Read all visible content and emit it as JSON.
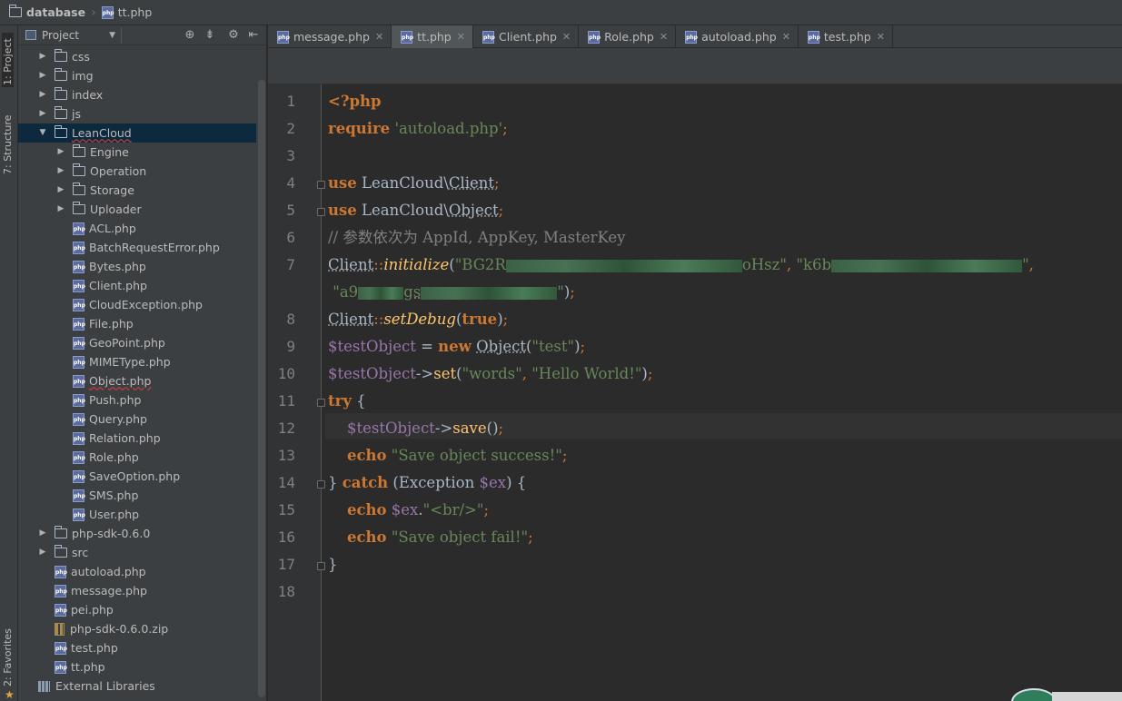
{
  "breadcrumb": {
    "root": "database",
    "file": "tt.php"
  },
  "toolwindows": {
    "project": "1: Project",
    "structure": "7: Structure",
    "favorites": "2: Favorites"
  },
  "project_panel": {
    "view_label": "Project"
  },
  "tree": [
    {
      "label": "css",
      "type": "folder",
      "depth": 1,
      "expanded": false
    },
    {
      "label": "img",
      "type": "folder",
      "depth": 1,
      "expanded": false
    },
    {
      "label": "index",
      "type": "folder",
      "depth": 1,
      "expanded": false
    },
    {
      "label": "js",
      "type": "folder",
      "depth": 1,
      "expanded": false
    },
    {
      "label": "LeanCloud",
      "type": "folder",
      "depth": 1,
      "expanded": true,
      "selected": true
    },
    {
      "label": "Engine",
      "type": "folder",
      "depth": 2,
      "expanded": false
    },
    {
      "label": "Operation",
      "type": "folder",
      "depth": 2,
      "expanded": false
    },
    {
      "label": "Storage",
      "type": "folder",
      "depth": 2,
      "expanded": false
    },
    {
      "label": "Uploader",
      "type": "folder",
      "depth": 2,
      "expanded": false
    },
    {
      "label": "ACL.php",
      "type": "php",
      "depth": 2
    },
    {
      "label": "BatchRequestError.php",
      "type": "php",
      "depth": 2
    },
    {
      "label": "Bytes.php",
      "type": "php",
      "depth": 2
    },
    {
      "label": "Client.php",
      "type": "php",
      "depth": 2
    },
    {
      "label": "CloudException.php",
      "type": "php",
      "depth": 2
    },
    {
      "label": "File.php",
      "type": "php",
      "depth": 2
    },
    {
      "label": "GeoPoint.php",
      "type": "php",
      "depth": 2
    },
    {
      "label": "MIMEType.php",
      "type": "php",
      "depth": 2
    },
    {
      "label": "Object.php",
      "type": "php",
      "depth": 2,
      "error": true
    },
    {
      "label": "Push.php",
      "type": "php",
      "depth": 2
    },
    {
      "label": "Query.php",
      "type": "php",
      "depth": 2
    },
    {
      "label": "Relation.php",
      "type": "php",
      "depth": 2
    },
    {
      "label": "Role.php",
      "type": "php",
      "depth": 2
    },
    {
      "label": "SaveOption.php",
      "type": "php",
      "depth": 2
    },
    {
      "label": "SMS.php",
      "type": "php",
      "depth": 2
    },
    {
      "label": "User.php",
      "type": "php",
      "depth": 2
    },
    {
      "label": "php-sdk-0.6.0",
      "type": "folder",
      "depth": 1,
      "expanded": false
    },
    {
      "label": "src",
      "type": "folder",
      "depth": 1,
      "expanded": false
    },
    {
      "label": "autoload.php",
      "type": "php",
      "depth": 1
    },
    {
      "label": "message.php",
      "type": "php",
      "depth": 1
    },
    {
      "label": "pei.php",
      "type": "php",
      "depth": 1
    },
    {
      "label": "php-sdk-0.6.0.zip",
      "type": "zip",
      "depth": 1
    },
    {
      "label": "test.php",
      "type": "php",
      "depth": 1
    },
    {
      "label": "tt.php",
      "type": "php",
      "depth": 1
    },
    {
      "label": "External Libraries",
      "type": "lib",
      "depth": 0
    }
  ],
  "tabs": [
    {
      "label": "message.php",
      "active": false
    },
    {
      "label": "tt.php",
      "active": true
    },
    {
      "label": "Client.php",
      "active": false
    },
    {
      "label": "Role.php",
      "active": false
    },
    {
      "label": "autoload.php",
      "active": false
    },
    {
      "label": "test.php",
      "active": false
    }
  ],
  "line_numbers": [
    "1",
    "2",
    "3",
    "4",
    "5",
    "6",
    "7",
    "8",
    "9",
    "10",
    "11",
    "12",
    "13",
    "14",
    "15",
    "16",
    "17",
    "18"
  ],
  "code": {
    "php_open": "<?php",
    "require_kw": "require",
    "require_str": "'autoload.php'",
    "use_kw": "use",
    "ns1": "LeanCloud\\",
    "cls1": "Client",
    "ns2": "LeanCloud\\",
    "cls2": "Object",
    "comment": "// 参数依次为 AppId, AppKey, MasterKey",
    "client": "Client",
    "dcolon": "::",
    "init_fn": "initialize",
    "appid_start": "\"BG2R",
    "appid_end": "oHsz\"",
    "appkey_start": "\"k6b",
    "masterkey_start": "\"a9",
    "masterkey_mid": "gs",
    "setdebug_fn": "setDebug",
    "true_kw": "true",
    "var_testobj": "$testObject",
    "new_kw": "new",
    "object_cls": "Object",
    "str_test": "\"test\"",
    "set_fn": "set",
    "str_words": "\"words\"",
    "str_hello": "\"Hello World!\"",
    "try_kw": "try",
    "save_fn": "save",
    "echo_kw": "echo",
    "str_success": "\"Save object success!\"",
    "catch_kw": "catch",
    "exception_cls": "Exception",
    "var_ex": "$ex",
    "str_br": "\"<br/>\"",
    "str_fail": "\"Save object fail!\""
  },
  "colors": {
    "keyword": "#cc7832",
    "string": "#6a8759",
    "variable": "#9876aa",
    "function": "#ffc66d",
    "comment": "#808080",
    "selection": "#0d293e"
  }
}
